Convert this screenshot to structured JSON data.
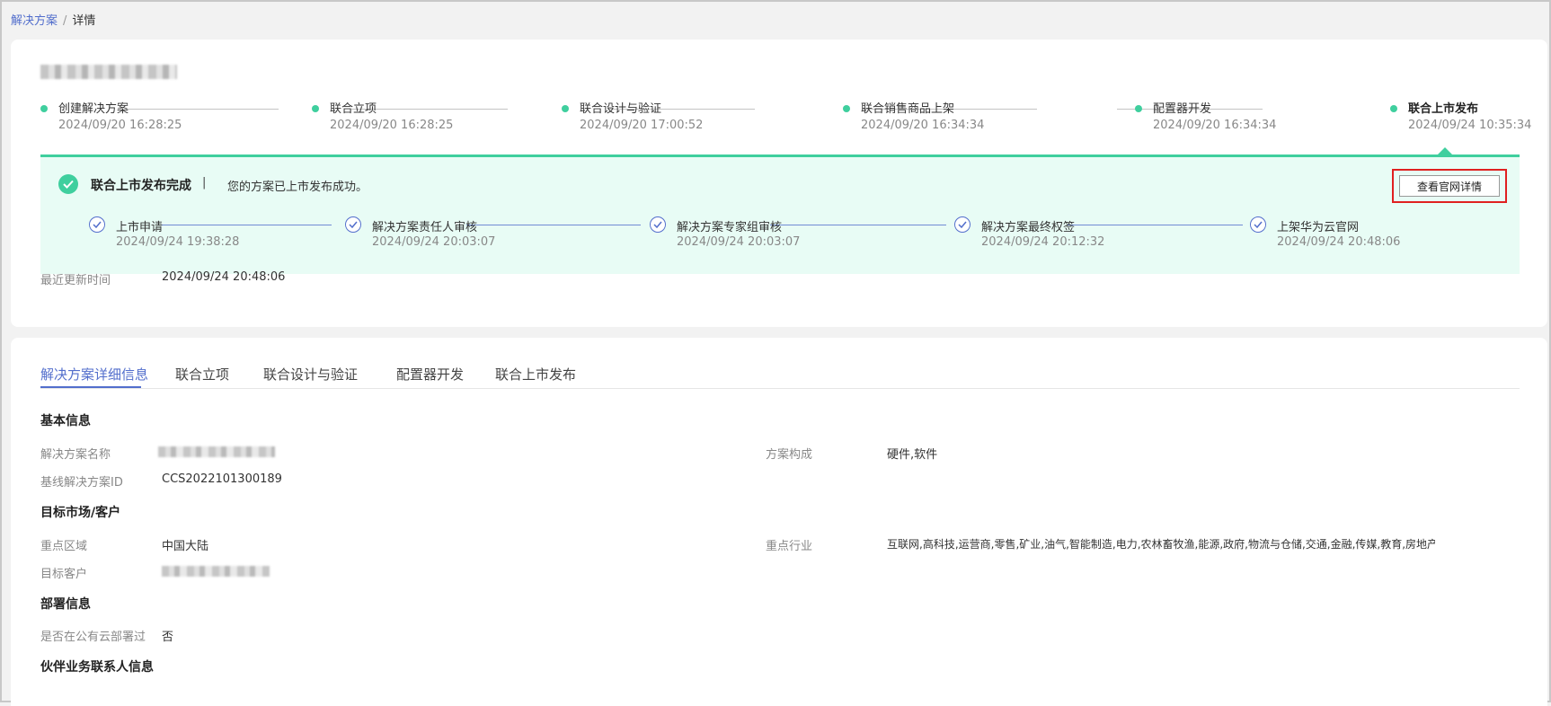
{
  "breadcrumb": {
    "parent": "解决方案",
    "separator": "/",
    "current": "详情"
  },
  "progress": {
    "steps": [
      {
        "name": "创建解决方案",
        "time": "2024/09/20 16:28:25"
      },
      {
        "name": "联合立项",
        "time": "2024/09/20 16:28:25"
      },
      {
        "name": "联合设计与验证",
        "time": "2024/09/20 17:00:52"
      },
      {
        "name": "联合销售商品上架",
        "time": "2024/09/20 16:34:34"
      },
      {
        "name": "配置器开发",
        "time": "2024/09/20 16:34:34"
      },
      {
        "name": "联合上市发布",
        "time": "2024/09/24 10:35:34"
      }
    ],
    "active_color": "#3fcf9e"
  },
  "status_panel": {
    "title": "联合上市发布完成",
    "divider": "|",
    "message": "您的方案已上市发布成功。",
    "view_button": "查看官网详情",
    "substeps": [
      {
        "name": "上市申请",
        "time": "2024/09/24 19:38:28"
      },
      {
        "name": "解决方案责任人审核",
        "time": "2024/09/24 20:03:07"
      },
      {
        "name": "解决方案专家组审核",
        "time": "2024/09/24 20:03:07"
      },
      {
        "name": "解决方案最终权签",
        "time": "2024/09/24 20:12:32"
      },
      {
        "name": "上架华为云官网",
        "time": "2024/09/24 20:48:06"
      }
    ]
  },
  "last_update": {
    "label": "最近更新时间",
    "value": "2024/09/24 20:48:06"
  },
  "tabs": [
    {
      "label": "解决方案详细信息",
      "active": true
    },
    {
      "label": "联合立项",
      "active": false
    },
    {
      "label": "联合设计与验证",
      "active": false
    },
    {
      "label": "配置器开发",
      "active": false
    },
    {
      "label": "联合上市发布",
      "active": false
    }
  ],
  "details": {
    "basic": {
      "title": "基本信息",
      "solution_name_label": "解决方案名称",
      "composition_label": "方案构成",
      "composition_value": "硬件,软件",
      "baseline_id_label": "基线解决方案ID",
      "baseline_id_value": "CCS2022101300189"
    },
    "market": {
      "title": "目标市场/客户",
      "region_label": "重点区域",
      "region_value": "中国大陆",
      "industry_label": "重点行业",
      "industry_value": "互联网,高科技,运营商,零售,矿业,油气,智能制造,电力,农林畜牧渔,能源,政府,物流与仓储,交通,金融,传媒,教育,房地产...",
      "customer_label": "目标客户"
    },
    "deploy": {
      "title": "部署信息",
      "public_cloud_label": "是否在公有云部署过",
      "public_cloud_value": "否"
    },
    "contact": {
      "title": "伙伴业务联系人信息"
    }
  },
  "colors": {
    "accent": "#526ecc",
    "success": "#3fcf9e",
    "panel_bg": "#e8fcf5",
    "highlight": "#e02020"
  }
}
